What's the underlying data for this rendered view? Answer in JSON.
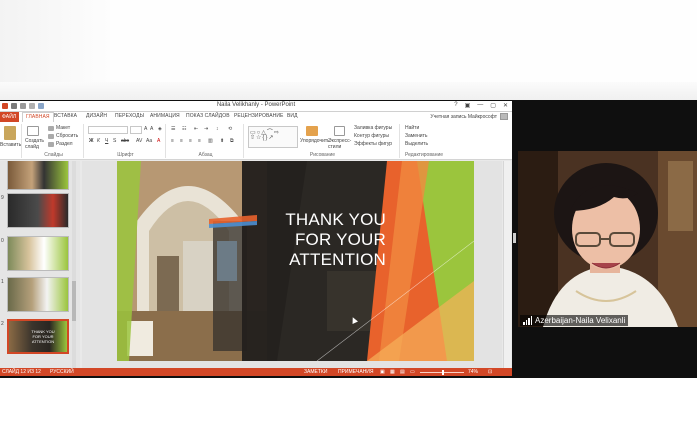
{
  "window": {
    "title": "Naila Velikhanly - PowerPoint",
    "controls": [
      "?",
      "▣",
      "—",
      "▢",
      "✕"
    ]
  },
  "tabs": {
    "file": "ФАЙЛ",
    "items": [
      "ГЛАВНАЯ",
      "ВСТАВКА",
      "ДИЗАЙН",
      "ПЕРЕХОДЫ",
      "АНИМАЦИЯ",
      "ПОКАЗ СЛАЙДОВ",
      "РЕЦЕНЗИРОВАНИЕ",
      "ВИД"
    ],
    "active_index": 0,
    "account": "Учетная запись Майкрософт"
  },
  "ribbon": {
    "clipboard": {
      "paste": "Вставить",
      "label": "Буфер обмена"
    },
    "slides": {
      "new_slide": "Создать слайд",
      "layout": "Макет",
      "reset": "Сбросить",
      "section": "Раздел",
      "label": "Слайды"
    },
    "font": {
      "label": "Шрифт"
    },
    "paragraph": {
      "label": "Абзац"
    },
    "drawing": {
      "arrange": "Упорядочить",
      "quick_styles": "Экспресс-стили",
      "fill": "Заливка фигуры",
      "outline": "Контур фигуры",
      "effects": "Эффекты фигур",
      "label": "Рисование"
    },
    "editing": {
      "find": "Найти",
      "replace": "Заменить",
      "select": "Выделить",
      "label": "Редактирование"
    }
  },
  "thumbnails": [
    {
      "num": "",
      "selected": false
    },
    {
      "num": "9",
      "selected": false
    },
    {
      "num": "0",
      "selected": false
    },
    {
      "num": "1",
      "selected": false
    },
    {
      "num": "2",
      "selected": true,
      "caption": "THANK YOU FOR YOUR ATTENTION"
    }
  ],
  "slide": {
    "headline_lines": [
      "THANK YOU",
      "FOR YOUR",
      "ATTENTION"
    ]
  },
  "status": {
    "slide_info": "СЛАЙД 12 ИЗ 12",
    "language": "РУССКИЙ",
    "notes": "ЗАМЕТКИ",
    "comments": "ПРИМЕЧАНИЯ",
    "zoom": "74%"
  },
  "webcam": {
    "name": "Azerbaijan-Naila Velixanli"
  },
  "background_ghost": {
    "items": [
      "Вставить",
      "Создать",
      "слайд",
      "Слайды",
      "Буфер обмена",
      "Сбросить",
      "Раздел"
    ]
  },
  "colors": {
    "accent": "#d24726",
    "green": "#9bc53d",
    "orange": "#e8622c"
  }
}
